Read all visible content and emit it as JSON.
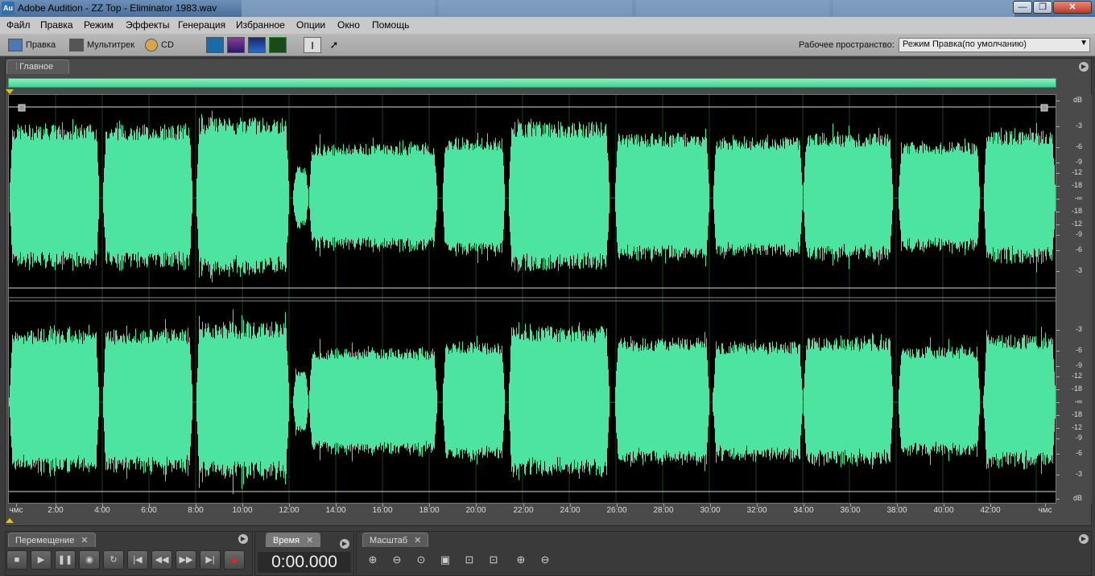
{
  "window": {
    "title": "Adobe Audition - ZZ Top - Eliminator 1983.wav",
    "app_icon_text": "Au",
    "controls": {
      "minimize": "—",
      "maximize": "❐",
      "close": "✕"
    }
  },
  "menubar": {
    "items": [
      "Файл",
      "Правка",
      "Режим",
      "Эффекты",
      "Генерация",
      "Избранное",
      "Опции",
      "Окно",
      "Помощь"
    ]
  },
  "toolbar": {
    "edit_label": "Правка",
    "multitrack_label": "Мультитрек",
    "cd_label": "CD",
    "view_buttons": [
      "waveform-view-icon",
      "spectral-frequency-icon",
      "spectral-pan-icon",
      "phase-view-icon"
    ],
    "tools": [
      "time-selection-icon",
      "hybrid-tool-icon"
    ],
    "workspace_label": "Рабочее пространство:",
    "workspace_value": "Режим Правка(по умолчанию)"
  },
  "main_panel": {
    "tab_label": "Главное",
    "db_scale_top": [
      "dB",
      "-3",
      "-6",
      "-9",
      "-12",
      "-18",
      "-∞",
      "-18",
      "-12",
      "-9",
      "-6",
      "-3"
    ],
    "db_scale_bottom": [
      "-3",
      "-6",
      "-9",
      "-12",
      "-18",
      "-∞",
      "-18",
      "-12",
      "-9",
      "-6",
      "-3",
      "dB"
    ],
    "time_labels": [
      "чмс",
      "2:00",
      "4:00",
      "6:00",
      "8:00",
      "10:00",
      "12:00",
      "14:00",
      "16:00",
      "18:00",
      "20:00",
      "22:00",
      "24:00",
      "26:00",
      "28:00",
      "30:00",
      "32:00",
      "34:00",
      "36:00",
      "38:00",
      "40:00",
      "42:00",
      "чмс"
    ],
    "waveform_color": "#4de3a0",
    "background_color": "#000000"
  },
  "bottom": {
    "transport_tab": "Перемещение",
    "time_tab": "Время",
    "zoom_tab": "Масштаб",
    "time_value": "0:00.000",
    "transport_buttons": [
      "stop-icon",
      "play-icon",
      "pause-icon",
      "play-from-cursor-icon",
      "loop-icon",
      "go-to-start-icon",
      "rewind-icon",
      "fast-forward-icon",
      "go-to-end-icon",
      "record-icon"
    ],
    "zoom_buttons": [
      "zoom-in-center-icon",
      "zoom-out-center-icon",
      "zoom-out-full-icon",
      "zoom-selection-icon",
      "zoom-left-icon",
      "zoom-right-icon",
      "zoom-in-vertical-icon",
      "zoom-out-vertical-icon"
    ]
  }
}
